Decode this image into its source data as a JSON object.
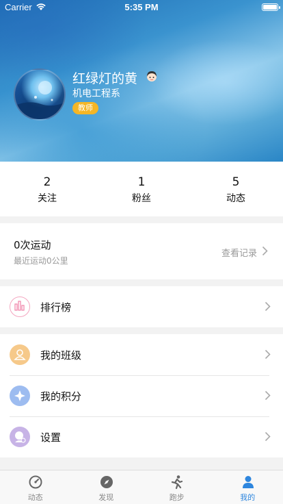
{
  "status_bar": {
    "carrier": "Carrier",
    "time": "5:35 PM"
  },
  "profile": {
    "name": "红绿灯的黄",
    "department": "机电工程系",
    "role_badge": "教师",
    "avatar_icon": "profile-avatar-image",
    "emoji_icon": "girl-face-emoji"
  },
  "stats": [
    {
      "value": "2",
      "label": "关注"
    },
    {
      "value": "1",
      "label": "粉丝"
    },
    {
      "value": "5",
      "label": "动态"
    }
  ],
  "exercise": {
    "title": "0次运动",
    "subtitle": "最近运动0公里",
    "record_link": "查看记录"
  },
  "menu": {
    "ranking": {
      "label": "排行榜",
      "icon": "bar-chart-icon",
      "color": "#f4a6c0"
    },
    "items": [
      {
        "label": "我的班级",
        "icon": "class-icon",
        "color": "#f6c98a"
      },
      {
        "label": "我的积分",
        "icon": "points-icon",
        "color": "#9dbcf0"
      },
      {
        "label": "设置",
        "icon": "settings-icon",
        "color": "#c7b3e6"
      }
    ]
  },
  "tabbar": [
    {
      "label": "动态",
      "icon": "dashboard-icon",
      "active": false
    },
    {
      "label": "发现",
      "icon": "compass-icon",
      "active": false
    },
    {
      "label": "跑步",
      "icon": "runner-icon",
      "active": false
    },
    {
      "label": "我的",
      "icon": "person-icon",
      "active": true
    }
  ],
  "colors": {
    "accent": "#2e86de",
    "badge": "#f5b626"
  }
}
